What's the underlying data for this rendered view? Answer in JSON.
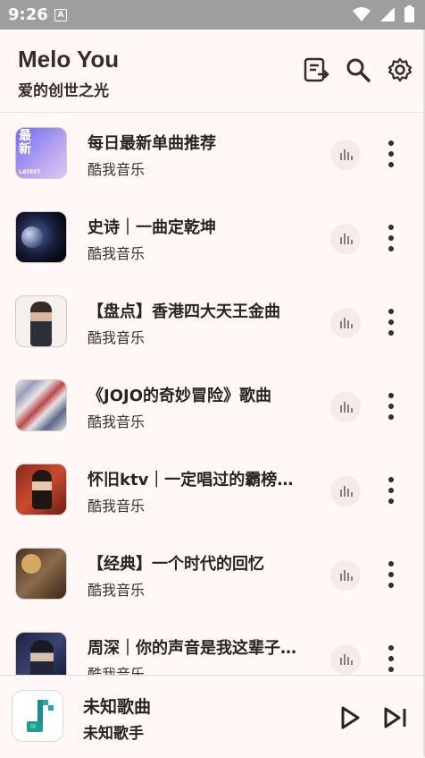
{
  "status": {
    "time": "9:26",
    "notification_badge": "A",
    "icons": [
      "wifi-icon",
      "signal-icon",
      "battery-icon"
    ]
  },
  "header": {
    "title": "Melo You",
    "subtitle": "爱的创世之光",
    "actions": [
      "playlist-icon",
      "search-icon",
      "settings-icon"
    ]
  },
  "playlists": [
    {
      "title": "每日最新单曲推荐",
      "source": "酷我音乐",
      "cover_text": "最新",
      "cover_caption": "LATEST"
    },
    {
      "title": "史诗｜一曲定乾坤",
      "source": "酷我音乐"
    },
    {
      "title": "【盘点】香港四大天王金曲",
      "source": "酷我音乐"
    },
    {
      "title": "《JOJO的奇妙冒险》歌曲",
      "source": "酷我音乐"
    },
    {
      "title": "怀旧ktv｜一定唱过的霸榜金曲",
      "source": "酷我音乐"
    },
    {
      "title": "【经典】一个时代的回忆",
      "source": "酷我音乐"
    },
    {
      "title": "周深｜你的声音是我这辈子最好的礼物",
      "source": "酷我音乐"
    }
  ],
  "player": {
    "title": "未知歌曲",
    "artist": "未知歌手",
    "controls": [
      "play-icon",
      "skip-next-icon"
    ]
  },
  "colors": {
    "background": "#fff8f6",
    "accent": "#3b2a2a",
    "status_bar": "#9e9e9e"
  }
}
